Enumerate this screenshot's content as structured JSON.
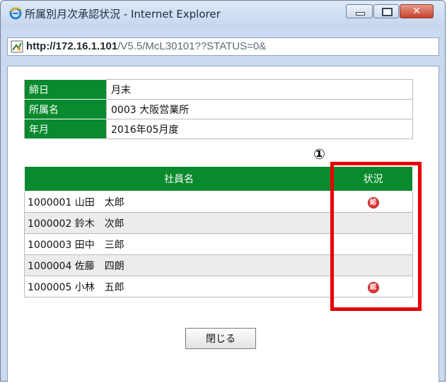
{
  "window": {
    "title": "所属別月次承認状況 - Internet Explorer",
    "address_host": "http://172.16.1.101",
    "address_path": "/V5.5/McL30101??STATUS=0&"
  },
  "info": {
    "rows": [
      {
        "label": "締日",
        "value": "月末"
      },
      {
        "label": "所属名",
        "value": "0003 大阪営業所"
      },
      {
        "label": "年月",
        "value": "2016年05月度"
      }
    ]
  },
  "employees": {
    "col_name": "社員名",
    "col_status": "状況",
    "rows": [
      {
        "name": "1000001 山田　太郎",
        "approved": true,
        "stamp_char": "認"
      },
      {
        "name": "1000002 鈴木　次郎",
        "approved": false,
        "stamp_char": ""
      },
      {
        "name": "1000003 田中　三郎",
        "approved": false,
        "stamp_char": ""
      },
      {
        "name": "1000004 佐藤　四朗",
        "approved": false,
        "stamp_char": ""
      },
      {
        "name": "1000005 小林　五郎",
        "approved": true,
        "stamp_char": "認"
      }
    ]
  },
  "annotation": {
    "marker": "①",
    "color": "#e80000"
  },
  "buttons": {
    "close_label": "閉じる"
  },
  "colors": {
    "header_green": "#0a8a2e",
    "stamp_red": "#e33b3b"
  }
}
